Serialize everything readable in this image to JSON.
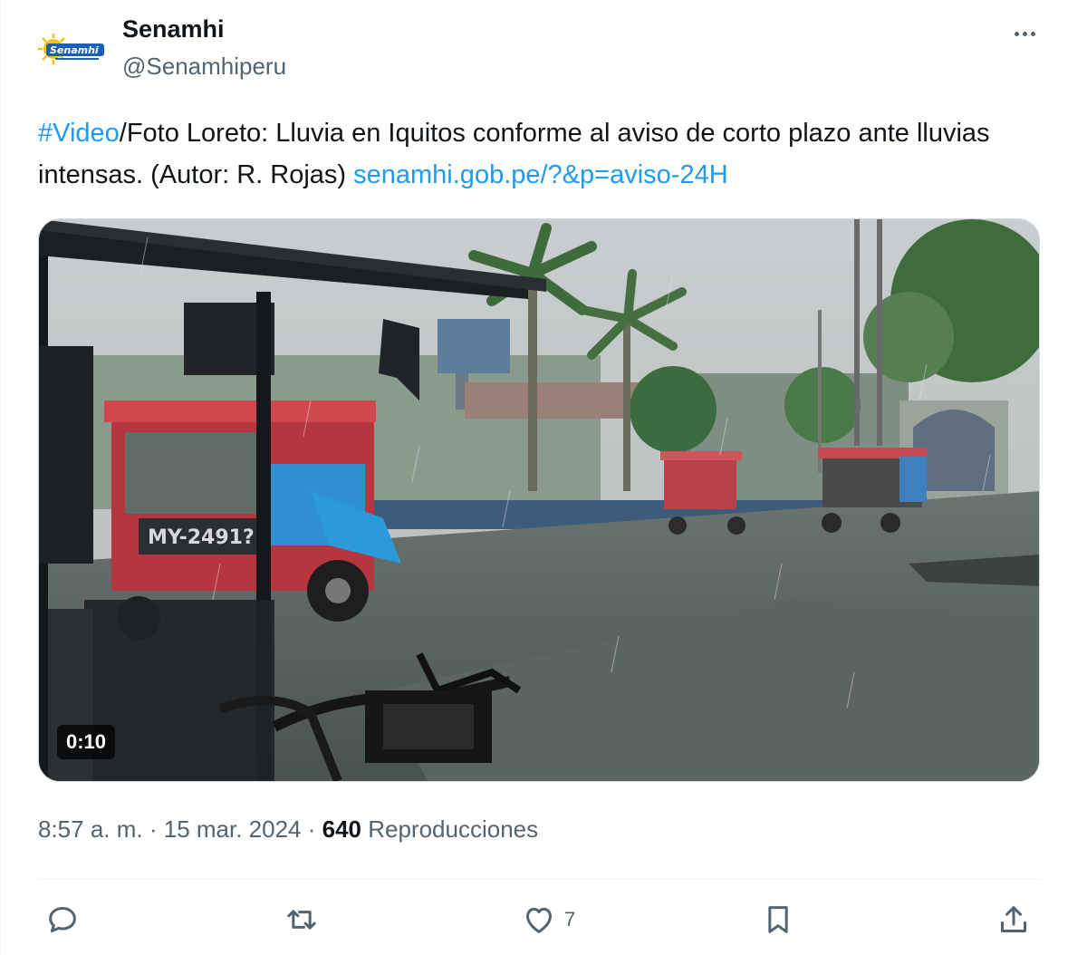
{
  "author": {
    "name": "Senamhi",
    "handle": "@Senamhiperu",
    "logo_text": "Senamhi"
  },
  "tweet": {
    "hashtag": "#Video",
    "text_body": "/Foto Loreto: Lluvia en Iquitos conforme al aviso de corto plazo ante lluvias intensas. (Autor: R. Rojas) ",
    "link": "senamhi.gob.pe/?&p=aviso-24H"
  },
  "media": {
    "duration": "0:10",
    "plate_text": "MY-2491?"
  },
  "meta": {
    "time": "8:57 a. m.",
    "sep1": " · ",
    "date": "15 mar. 2024",
    "sep2": " · ",
    "views_count": "640",
    "views_label": " Reproducciones"
  },
  "actions": {
    "like_count": "7"
  },
  "icons": {
    "more": "more-dots-icon",
    "reply": "reply-icon",
    "retweet": "retweet-icon",
    "like": "heart-icon",
    "bookmark": "bookmark-icon",
    "share": "share-icon"
  },
  "colors": {
    "link": "#1d9bf0",
    "secondary_text": "#536471",
    "primary_text": "#0f1419"
  }
}
